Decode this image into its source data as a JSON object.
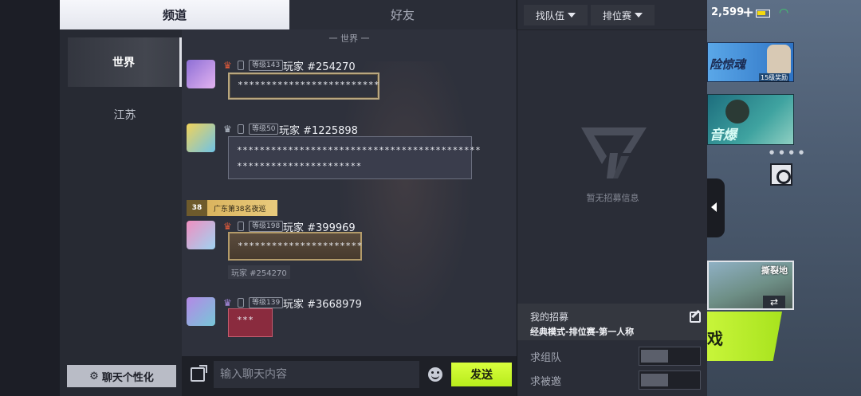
{
  "tabs": {
    "channel": "频道",
    "friends": "好友"
  },
  "sidebar": {
    "items": [
      {
        "label": "世界",
        "selected": true
      },
      {
        "label": "江苏",
        "selected": false
      }
    ],
    "customize_label": "聊天个性化"
  },
  "chat": {
    "divider": "一 世界 一",
    "messages": [
      {
        "level": "等级143",
        "name": "玩家 #254270",
        "text": "*************************"
      },
      {
        "level": "等级50",
        "name": "玩家 #1225898",
        "text_line1": "*******************************************",
        "text_line2": "**********************"
      },
      {
        "banner_badge": "38",
        "banner_text": "广东第38名夜巡",
        "level": "等级198",
        "name": "玩家 #399969",
        "text": "**********************",
        "quote": "玩家 #254270"
      },
      {
        "level": "等级139",
        "name": "玩家 #3668979",
        "text": "***"
      }
    ]
  },
  "input": {
    "placeholder": "输入聊天内容",
    "send_label": "发送"
  },
  "recruit": {
    "filter_team": "找队伍",
    "filter_rank": "排位赛",
    "empty_text": "暂无招募信息",
    "my_recruit_title": "我的招募",
    "my_recruit_mode": "经典模式-排位赛-第一人称",
    "toggles": [
      {
        "label": "求组队",
        "on": false
      },
      {
        "label": "求被邀",
        "on": false
      }
    ]
  },
  "lobby": {
    "currency": "2,599",
    "plus": "+",
    "event_title": "险惊魂",
    "event_sub": "15级奖励",
    "promo_title": "音爆",
    "carousel_dots": "● ● ● ●",
    "map_label": "撕裂地",
    "swap": "⇄",
    "start_label": "戏"
  },
  "colors": {
    "send_button": "#c8f53a",
    "bubble_red": "#8a2b3e",
    "bubble_gold": "#b9a77f",
    "wifi": "#3cd66a"
  }
}
